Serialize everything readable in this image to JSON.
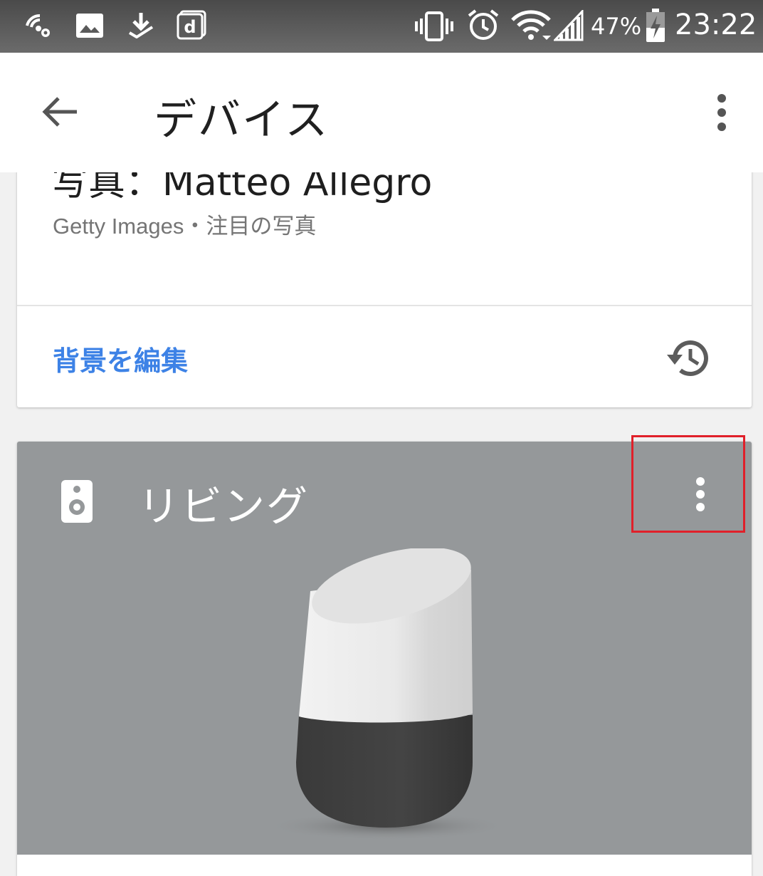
{
  "status_bar": {
    "battery_percent": "47%",
    "time": "23:22",
    "icons": [
      "wifi-settings-icon",
      "image-icon",
      "download-icon",
      "d-app-icon",
      "vibrate-icon",
      "alarm-icon",
      "wifi-icon",
      "signal-icon",
      "battery-charging-icon"
    ]
  },
  "app_bar": {
    "title": "デバイス",
    "back_icon": "arrow-back-icon",
    "menu_icon": "more-vert-icon"
  },
  "background_card": {
    "photo_credit": "写真：Matteo Allegro",
    "photo_source": "Getty Images・注目の写真",
    "edit_label": "背景を編集",
    "history_icon": "history-icon"
  },
  "device_card": {
    "room_name": "リビング",
    "room_icon": "speaker-icon",
    "menu_icon": "more-vert-icon",
    "device_image": "google-home-device"
  },
  "colors": {
    "status_bar": "#5a5a5a",
    "link_blue": "#3d82e6",
    "device_card_bg": "#95989a",
    "highlight": "#e0202a"
  }
}
